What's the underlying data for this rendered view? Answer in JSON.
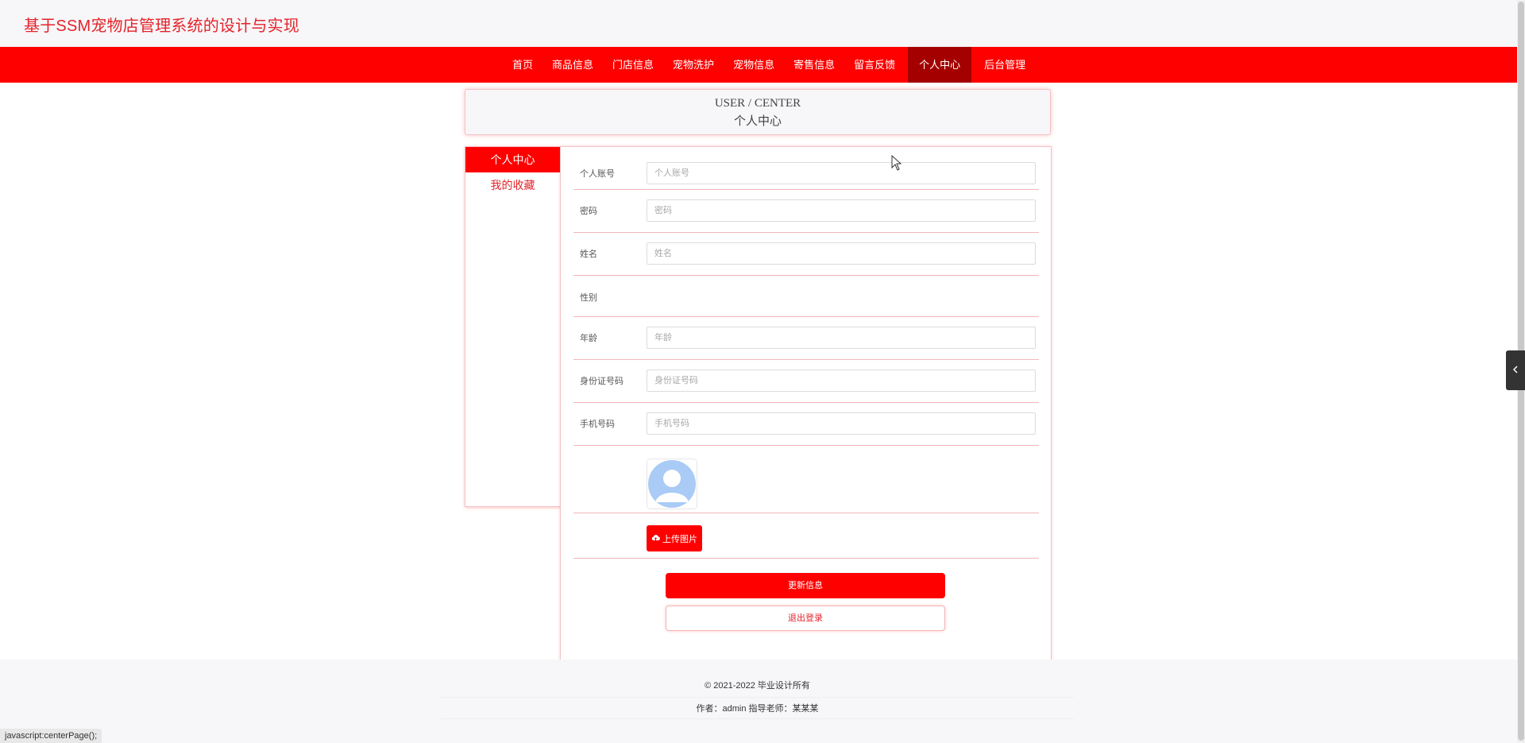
{
  "header": {
    "title": "基于SSM宠物店管理系统的设计与实现"
  },
  "nav": {
    "items": [
      {
        "label": "首页"
      },
      {
        "label": "商品信息"
      },
      {
        "label": "门店信息"
      },
      {
        "label": "宠物洗护"
      },
      {
        "label": "宠物信息"
      },
      {
        "label": "寄售信息"
      },
      {
        "label": "留言反馈"
      },
      {
        "label": "个人中心",
        "active": true
      },
      {
        "label": "后台管理"
      }
    ]
  },
  "page_head": {
    "en": "USER / CENTER",
    "cn": "个人中心"
  },
  "sidebar": {
    "items": [
      {
        "label": "个人中心",
        "active": true
      },
      {
        "label": "我的收藏"
      }
    ]
  },
  "form": {
    "fields": [
      {
        "label": "个人账号",
        "placeholder": "个人账号",
        "value": ""
      },
      {
        "label": "密码",
        "placeholder": "密码",
        "value": ""
      },
      {
        "label": "姓名",
        "placeholder": "姓名",
        "value": ""
      },
      {
        "label": "性别"
      },
      {
        "label": "年龄",
        "placeholder": "年龄",
        "value": ""
      },
      {
        "label": "身份证号码",
        "placeholder": "身份证号码",
        "value": ""
      },
      {
        "label": "手机号码",
        "placeholder": "手机号码",
        "value": ""
      }
    ],
    "upload_label": "上传图片",
    "update_label": "更新信息",
    "logout_label": "退出登录"
  },
  "footer": {
    "copyright": "© 2021-2022 毕业设计所有",
    "author": "作者：admin 指导老师：某某某"
  },
  "status_bar": {
    "text": "javascript:centerPage();"
  },
  "colors": {
    "primary": "#ff0000",
    "active_nav": "#a40000",
    "accent_text": "#e3242b"
  },
  "icons": {
    "upload": "cloud-upload-icon",
    "side_toggle": "chevron-left-icon",
    "cursor": "mouse-cursor-icon",
    "avatar": "avatar-placeholder-icon"
  }
}
